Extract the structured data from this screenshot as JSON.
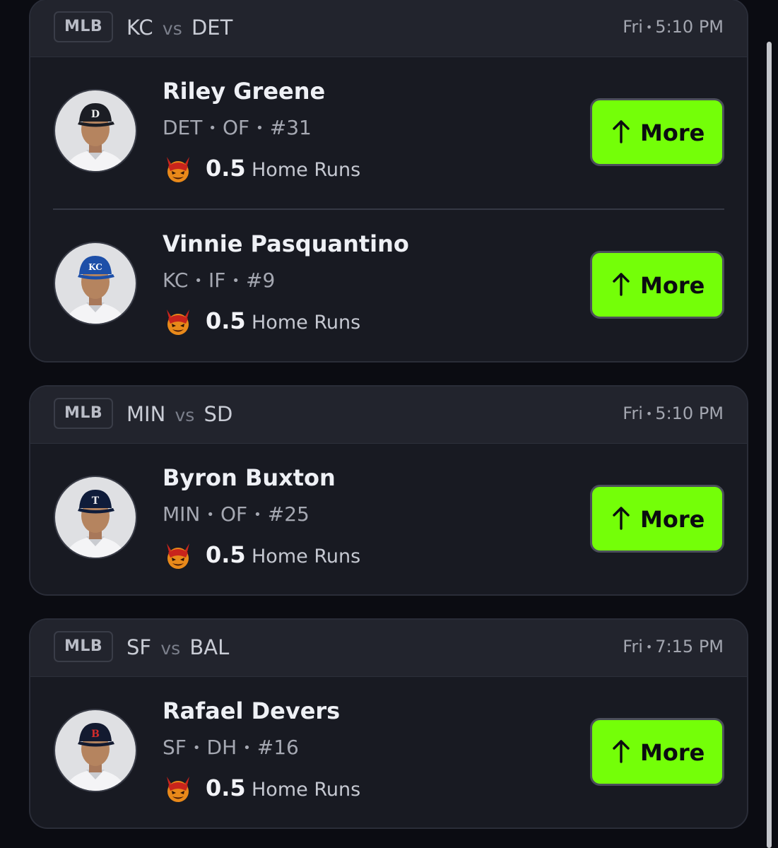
{
  "games": [
    {
      "league": "MLB",
      "team_a": "KC",
      "vs": "vs",
      "team_b": "DET",
      "day": "Fri",
      "time": "5:10 PM",
      "players": [
        {
          "name": "Riley Greene",
          "team": "DET",
          "position": "OF",
          "number": "#31",
          "stat_value": "0.5",
          "stat_label": "Home Runs",
          "button_label": "More",
          "cap_color": "#1b1d24",
          "cap_logo": "D"
        },
        {
          "name": "Vinnie Pasquantino",
          "team": "KC",
          "position": "IF",
          "number": "#9",
          "stat_value": "0.5",
          "stat_label": "Home Runs",
          "button_label": "More",
          "cap_color": "#1d4fa8",
          "cap_logo": "KC"
        }
      ]
    },
    {
      "league": "MLB",
      "team_a": "MIN",
      "vs": "vs",
      "team_b": "SD",
      "day": "Fri",
      "time": "5:10 PM",
      "players": [
        {
          "name": "Byron Buxton",
          "team": "MIN",
          "position": "OF",
          "number": "#25",
          "stat_value": "0.5",
          "stat_label": "Home Runs",
          "button_label": "More",
          "cap_color": "#0f1c3a",
          "cap_logo": "T"
        }
      ]
    },
    {
      "league": "MLB",
      "team_a": "SF",
      "vs": "vs",
      "team_b": "BAL",
      "day": "Fri",
      "time": "7:15 PM",
      "players": [
        {
          "name": "Rafael Devers",
          "team": "SF",
          "position": "DH",
          "number": "#16",
          "stat_value": "0.5",
          "stat_label": "Home Runs",
          "button_label": "More",
          "cap_color": "#131a30",
          "cap_logo": "B"
        }
      ]
    }
  ],
  "colors": {
    "accent": "#74ff08",
    "background": "#0b0c12",
    "card": "#181a22",
    "card_header": "#22242d"
  },
  "icons": {
    "stat": "demon-icon",
    "button": "arrow-up-icon"
  }
}
